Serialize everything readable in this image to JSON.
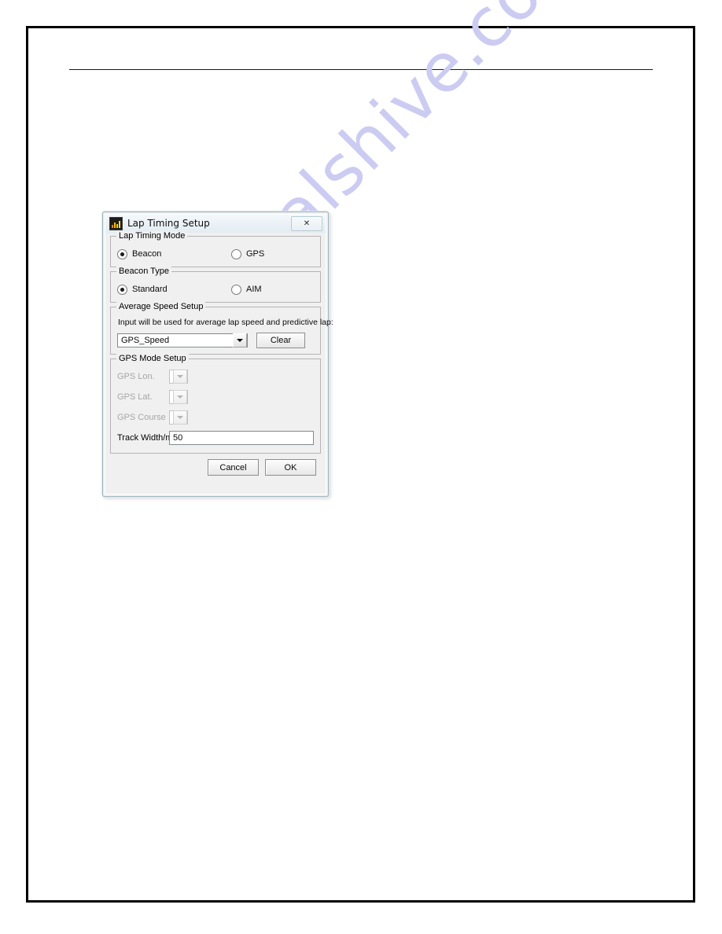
{
  "document": {
    "watermark": "manualshive.com"
  },
  "dialog": {
    "title": "Lap Timing Setup",
    "app_icon": "chart-app-icon",
    "close_label": "✕",
    "lap_timing_mode": {
      "title": "Lap Timing Mode",
      "options": [
        {
          "label": "Beacon",
          "selected": true
        },
        {
          "label": "GPS",
          "selected": false
        }
      ]
    },
    "beacon_type": {
      "title": "Beacon Type",
      "options": [
        {
          "label": "Standard",
          "selected": true
        },
        {
          "label": "AIM",
          "selected": false
        }
      ]
    },
    "average_speed_setup": {
      "title": "Average Speed Setup",
      "hint": "Input will be used for average lap speed and predictive lap:",
      "channel_value": "GPS_Speed",
      "clear_label": "Clear"
    },
    "gps_mode_setup": {
      "title": "GPS Mode Setup",
      "fields": [
        {
          "label": "GPS Lon.",
          "value": "",
          "disabled": true,
          "type": "combo"
        },
        {
          "label": "GPS Lat.",
          "value": "",
          "disabled": true,
          "type": "combo"
        },
        {
          "label": "GPS Course",
          "value": "",
          "disabled": true,
          "type": "combo"
        },
        {
          "label": "Track Width/m",
          "value": "50",
          "disabled": false,
          "type": "text"
        }
      ]
    },
    "footer": {
      "cancel_label": "Cancel",
      "ok_label": "OK"
    }
  }
}
